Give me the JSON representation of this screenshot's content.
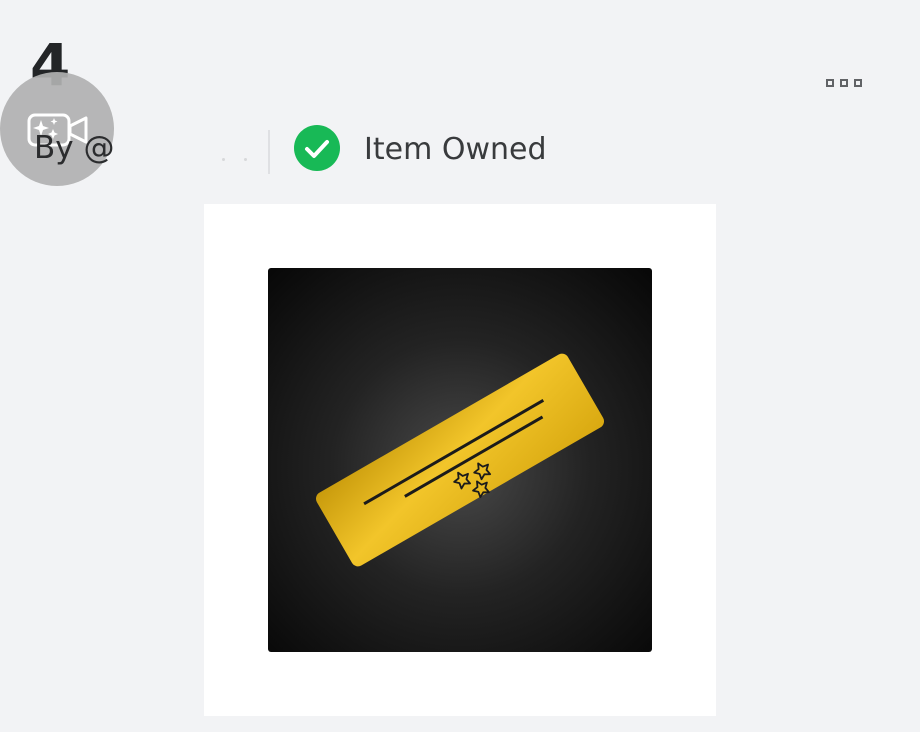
{
  "header": {
    "step_number": "4",
    "byline": "By @",
    "status_text": "Item Owned"
  },
  "icons": {
    "avatar": "camera-sparkle-icon",
    "status": "check-circle-icon",
    "menu": "more-options-icon"
  },
  "item": {
    "thumbnail": "golden-ticket-icon"
  },
  "colors": {
    "background": "#f2f3f5",
    "status_green": "#18b956",
    "ticket_gold": "#e0b41a"
  }
}
